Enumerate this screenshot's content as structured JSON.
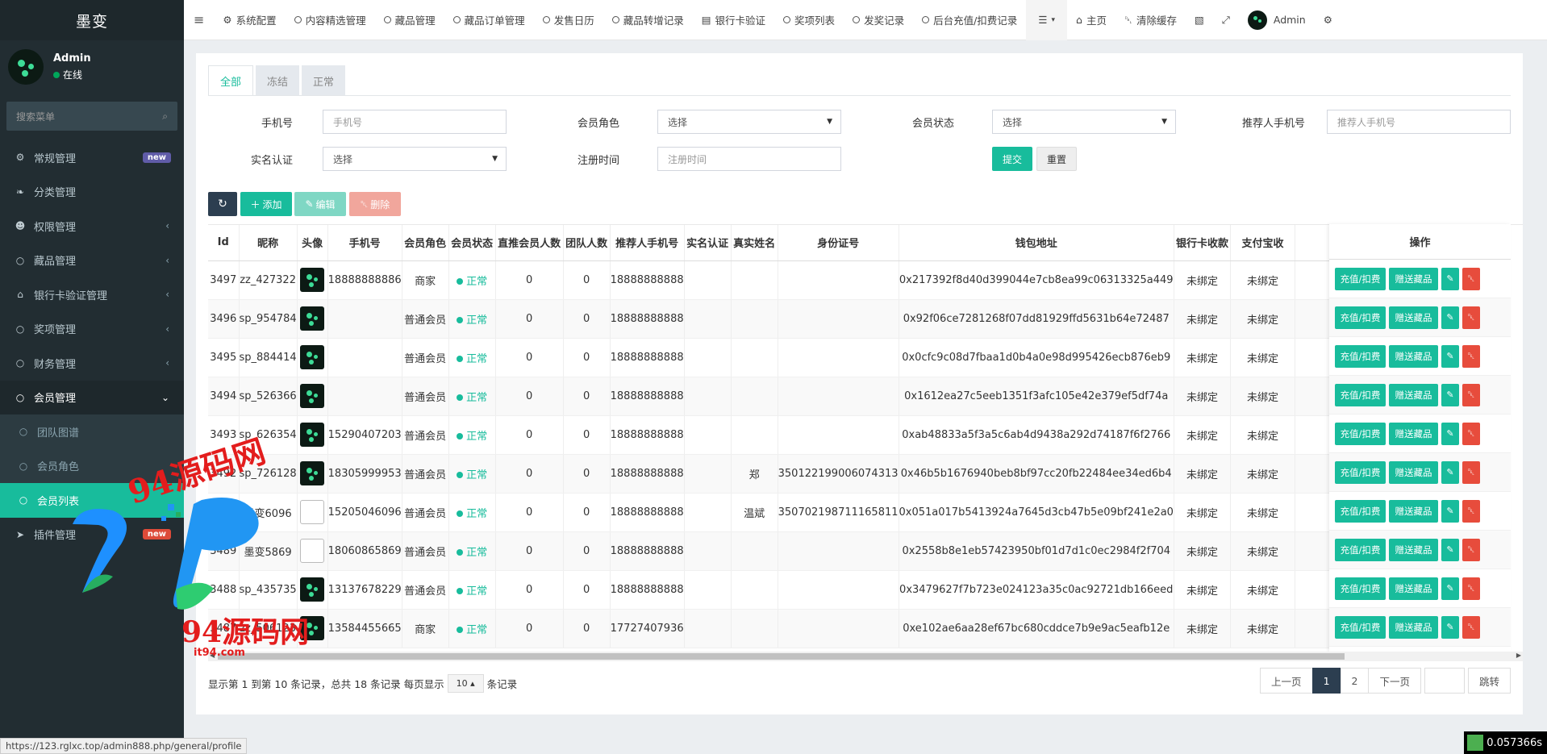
{
  "sidebar": {
    "brand": "墨变",
    "user": {
      "name": "Admin",
      "status": "在线"
    },
    "search_placeholder": "搜索菜单",
    "items": [
      {
        "label": "常规管理",
        "icon": "gears-icon",
        "badge": "new"
      },
      {
        "label": "分类管理",
        "icon": "leaf-icon"
      },
      {
        "label": "权限管理",
        "icon": "users-icon"
      },
      {
        "label": "藏品管理",
        "icon": "circle-icon"
      },
      {
        "label": "银行卡验证管理",
        "icon": "bank-icon"
      },
      {
        "label": "奖项管理",
        "icon": "circle-icon"
      },
      {
        "label": "财务管理",
        "icon": "circle-icon"
      },
      {
        "label": "会员管理",
        "icon": "circle-icon"
      }
    ],
    "sub_items": [
      "团队图谱",
      "会员角色",
      "会员列表"
    ],
    "plugin": {
      "label": "插件管理",
      "badge": "new"
    }
  },
  "topbar": {
    "tabs": [
      "系统配置",
      "内容精选管理",
      "藏品管理",
      "藏品订单管理",
      "发售日历",
      "藏品转增记录",
      "银行卡验证",
      "奖项列表",
      "发奖记录",
      "后台充值/扣费记录"
    ],
    "home": "主页",
    "clear_cache": "清除缓存",
    "admin": "Admin"
  },
  "filter_tabs": [
    "全部",
    "冻结",
    "正常"
  ],
  "filters": {
    "phone": {
      "label": "手机号",
      "placeholder": "手机号"
    },
    "role": {
      "label": "会员角色",
      "value": "选择"
    },
    "status": {
      "label": "会员状态",
      "value": "选择"
    },
    "ref_phone": {
      "label": "推荐人手机号",
      "placeholder": "推荐人手机号"
    },
    "realname": {
      "label": "实名认证",
      "value": "选择"
    },
    "regtime": {
      "label": "注册时间",
      "placeholder": "注册时间"
    },
    "submit": "提交",
    "reset": "重置"
  },
  "toolbar": {
    "add": "添加",
    "edit": "编辑",
    "delete": "删除"
  },
  "table": {
    "columns": [
      "Id",
      "昵称",
      "头像",
      "手机号",
      "会员角色",
      "会员状态",
      "直推会员人数",
      "团队人数",
      "推荐人手机号",
      "实名认证",
      "真实姓名",
      "身份证号",
      "钱包地址",
      "银行卡收款",
      "支付宝收"
    ],
    "op_header": "操作",
    "rows": [
      {
        "id": "3497",
        "nick": "zz_427322",
        "avatar": "ok",
        "phone": "18888888886",
        "role": "商家",
        "status": "正常",
        "direct": "0",
        "team": "0",
        "ref": "18888888888",
        "real": "",
        "name": "",
        "idno": "",
        "wallet": "0x217392f8d40d399044e7cb8ea99c06313325a449",
        "bank": "未绑定",
        "alipay": "未绑定"
      },
      {
        "id": "3496",
        "nick": "sp_954784",
        "avatar": "ok",
        "phone": "",
        "role": "普通会员",
        "status": "正常",
        "direct": "0",
        "team": "0",
        "ref": "18888888888",
        "real": "",
        "name": "",
        "idno": "",
        "wallet": "0x92f06ce7281268f07dd81929ffd5631b64e72487",
        "bank": "未绑定",
        "alipay": "未绑定"
      },
      {
        "id": "3495",
        "nick": "sp_884414",
        "avatar": "ok",
        "phone": "",
        "role": "普通会员",
        "status": "正常",
        "direct": "0",
        "team": "0",
        "ref": "18888888888",
        "real": "",
        "name": "",
        "idno": "",
        "wallet": "0x0cfc9c08d7fbaa1d0b4a0e98d995426ecb876eb9",
        "bank": "未绑定",
        "alipay": "未绑定"
      },
      {
        "id": "3494",
        "nick": "sp_526366",
        "avatar": "ok",
        "phone": "",
        "role": "普通会员",
        "status": "正常",
        "direct": "0",
        "team": "0",
        "ref": "18888888888",
        "real": "",
        "name": "",
        "idno": "",
        "wallet": "0x1612ea27c5eeb1351f3afc105e42e379ef5df74a",
        "bank": "未绑定",
        "alipay": "未绑定"
      },
      {
        "id": "3493",
        "nick": "sp_626354",
        "avatar": "ok",
        "phone": "15290407203",
        "role": "普通会员",
        "status": "正常",
        "direct": "0",
        "team": "0",
        "ref": "18888888888",
        "real": "",
        "name": "",
        "idno": "",
        "wallet": "0xab48833a5f3a5c6ab4d9438a292d74187f6f2766",
        "bank": "未绑定",
        "alipay": "未绑定"
      },
      {
        "id": "3492",
        "nick": "sp_726128",
        "avatar": "ok",
        "phone": "18305999953",
        "role": "普通会员",
        "status": "正常",
        "direct": "0",
        "team": "0",
        "ref": "18888888888",
        "real": "",
        "name": "郑",
        "idno": "350122199006074313",
        "wallet": "0x46b5b1676940beb8bf97cc20fb22484ee34ed6b4",
        "bank": "未绑定",
        "alipay": "未绑定"
      },
      {
        "id": "3490",
        "nick": "墨变6096",
        "avatar": "broken",
        "phone": "15205046096",
        "role": "普通会员",
        "status": "正常",
        "direct": "0",
        "team": "0",
        "ref": "18888888888",
        "real": "",
        "name": "温斌",
        "idno": "350702198711165811",
        "wallet": "0x051a017b5413924a7645d3cb47b5e09bf241e2a0",
        "bank": "未绑定",
        "alipay": "未绑定"
      },
      {
        "id": "3489",
        "nick": "墨变5869",
        "avatar": "broken",
        "phone": "18060865869",
        "role": "普通会员",
        "status": "正常",
        "direct": "0",
        "team": "0",
        "ref": "18888888888",
        "real": "",
        "name": "",
        "idno": "",
        "wallet": "0x2558b8e1eb57423950bf01d7d1c0ec2984f2f704",
        "bank": "未绑定",
        "alipay": "未绑定"
      },
      {
        "id": "3488",
        "nick": "sp_435735",
        "avatar": "ok",
        "phone": "13137678229",
        "role": "普通会员",
        "status": "正常",
        "direct": "0",
        "team": "0",
        "ref": "18888888888",
        "real": "",
        "name": "",
        "idno": "",
        "wallet": "0x3479627f7b723e024123a35c0ac92721db166eed",
        "bank": "未绑定",
        "alipay": "未绑定"
      },
      {
        "id": "3487",
        "nick": "zz_506123",
        "avatar": "ok",
        "phone": "13584455665",
        "role": "商家",
        "status": "正常",
        "direct": "0",
        "team": "0",
        "ref": "17727407936",
        "real": "",
        "name": "",
        "idno": "",
        "wallet": "0xe102ae6aa28ef67bc680cddce7b9e9ac5eafb12e",
        "bank": "未绑定",
        "alipay": "未绑定"
      }
    ],
    "op_buttons": {
      "recharge": "充值/扣费",
      "gift": "赠送藏品"
    }
  },
  "pagination": {
    "info_prefix": "显示第 1 到第 10 条记录，总共 18 条记录 每页显示",
    "page_size": "10",
    "info_suffix": "条记录",
    "prev": "上一页",
    "pages": [
      "1",
      "2"
    ],
    "next": "下一页",
    "jump": "跳转"
  },
  "statusbar": {
    "url": "https://123.rglxc.top/admin888.php/general/profile",
    "timer": "0.057366s"
  },
  "watermark": {
    "text1": "94源码网",
    "text2": "94源码网",
    "url": "it94.com"
  },
  "colors": {
    "accent": "#18bc9c",
    "sidebar": "#222d32",
    "danger": "#e74c3c",
    "edit": "#7fd7c4",
    "delete_disabled": "#f1a69c"
  }
}
